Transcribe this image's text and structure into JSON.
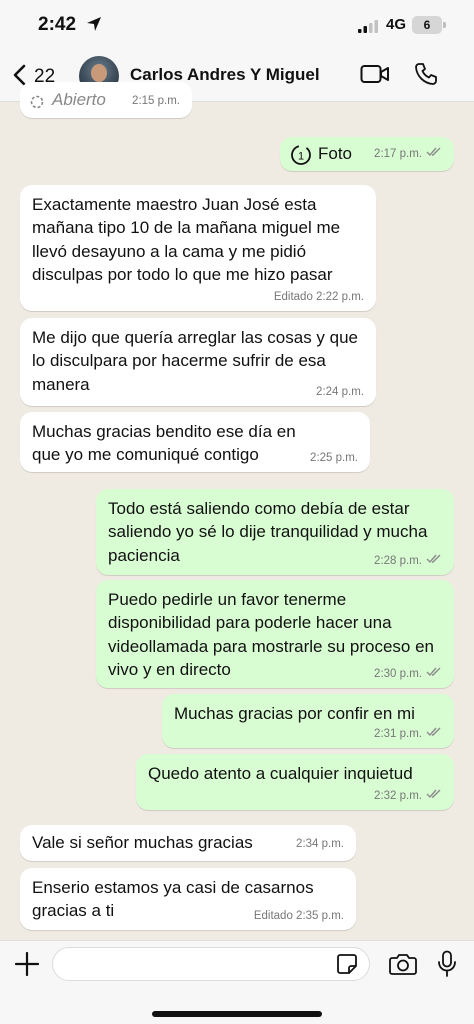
{
  "status": {
    "time": "2:42",
    "network": "4G",
    "battery": "6"
  },
  "header": {
    "back_count": "22",
    "contact_name": "Carlos Andres Y Miguel"
  },
  "messages": [
    {
      "direction": "in",
      "text": "Abierto",
      "time": "2:15 p.m."
    },
    {
      "direction": "out",
      "text": "Foto",
      "time": "2:17 p.m.",
      "status": "read"
    },
    {
      "direction": "in",
      "text": "Exactamente maestro Juan José esta mañana tipo 10 de la mañana miguel me llevó  desayuno a la cama y me pidió disculpas por todo lo que me hizo pasar",
      "time": "Editado 2:22 p.m."
    },
    {
      "direction": "in",
      "text": "Me dijo que quería arreglar las cosas y que lo disculpara por hacerme sufrir de esa manera",
      "time": "2:24 p.m."
    },
    {
      "direction": "in",
      "text": "Muchas gracias bendito ese día en que yo me comuniqué contigo",
      "time": "2:25 p.m."
    },
    {
      "direction": "out",
      "text": "Todo está saliendo como debía de estar saliendo yo sé lo dije tranquilidad y mucha paciencia",
      "time": "2:28 p.m.",
      "status": "read"
    },
    {
      "direction": "out",
      "text": "Puedo pedirle un favor tenerme disponibilidad para poderle hacer una videollamada para mostrarle su proceso en vivo y en directo",
      "time": "2:30 p.m.",
      "status": "read"
    },
    {
      "direction": "out",
      "text": "Muchas gracias por confir en mi",
      "time": "2:31 p.m.",
      "status": "read"
    },
    {
      "direction": "out",
      "text": "Quedo atento a cualquier inquietud",
      "time": "2:32 p.m.",
      "status": "read"
    },
    {
      "direction": "in",
      "text": "Vale si señor muchas gracias",
      "time": "2:34 p.m."
    },
    {
      "direction": "in",
      "text": "Enserio estamos ya casi de casarnos gracias a ti",
      "time": "Editado 2:35 p.m."
    }
  ],
  "composer": {
    "value": "",
    "placeholder": ""
  },
  "colors": {
    "chat_bg": "#efeae2",
    "incoming_bubble": "#ffffff",
    "outgoing_bubble": "#d9fdd3",
    "read_ticks": "#8a8a8a"
  },
  "icons": [
    "location-arrow-icon",
    "signal-icon",
    "back-chevron-icon",
    "video-call-icon",
    "phone-icon",
    "view-once-icon",
    "plus-icon",
    "sticker-icon",
    "camera-icon",
    "microphone-icon"
  ]
}
